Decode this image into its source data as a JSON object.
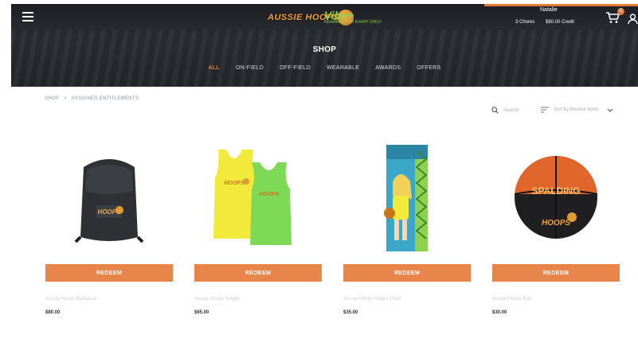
{
  "header": {
    "logo_primary": "AUSSIE HOOPS",
    "logo_secondary": "Vibe+",
    "logo_secondary_sub": "REWARDS FOR EVERY CHILD",
    "user_name": "Natalie",
    "chores": "3 Chores",
    "credit": "$80.00 Credit",
    "cart_count": "0",
    "title": "SHOP",
    "nav": [
      "ALL",
      "ON-FIELD",
      "OFF-FIELD",
      "WEARABLE",
      "AWARDS",
      "OFFERS"
    ],
    "active_nav": "ALL"
  },
  "breadcrumb": [
    "SHOP",
    ">",
    "ASSIGNED ENTITLEMENTS"
  ],
  "toolbar": {
    "search_placeholder": "Search",
    "sort_label": "Sort by Newest items"
  },
  "products": [
    {
      "name": "Aussie Hoops Backpack",
      "price": "$80.00",
      "button": "REDEEM",
      "image": "backpack"
    },
    {
      "name": "Aussie Hoops Singlet",
      "price": "$65.00",
      "button": "REDEEM",
      "image": "singlets"
    },
    {
      "name": "Aussie Hoops Height Chart",
      "price": "$35.00",
      "button": "REDEEM",
      "image": "height-chart"
    },
    {
      "name": "Aussie Hoops Ball",
      "price": "$30.00",
      "button": "REDEEM",
      "image": "basketball"
    }
  ],
  "colors": {
    "accent": "#e8854a",
    "header_bg": "#23262b",
    "vibe_green": "#8fd14f",
    "hoops_gold": "#f2a23a"
  }
}
